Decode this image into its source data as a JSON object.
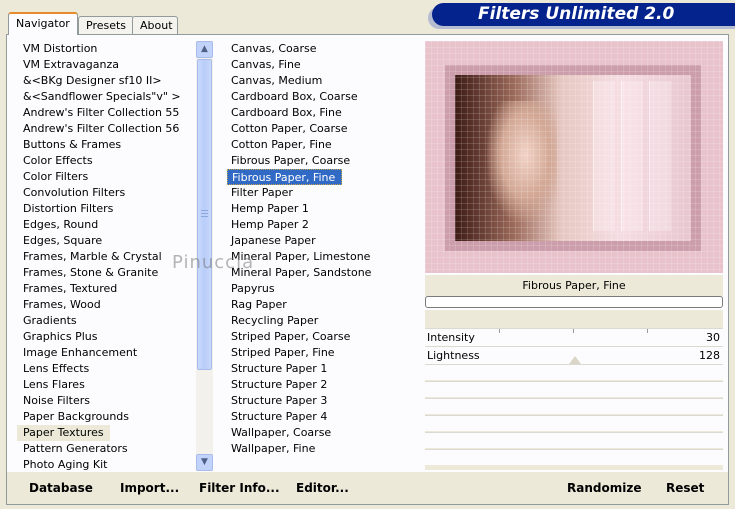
{
  "title": "Filters Unlimited 2.0",
  "tabs": [
    {
      "label": "Navigator",
      "active": true
    },
    {
      "label": "Presets",
      "active": false
    },
    {
      "label": "About",
      "active": false
    }
  ],
  "categories": [
    "VM Distortion",
    "VM Extravaganza",
    "&<BKg Designer sf10 II>",
    "&<Sandflower Specials\"v\" >",
    "Andrew's Filter Collection 55",
    "Andrew's Filter Collection 56",
    "Buttons & Frames",
    "Color Effects",
    "Color Filters",
    "Convolution Filters",
    "Distortion Filters",
    "Edges, Round",
    "Edges, Square",
    "Frames, Marble & Crystal",
    "Frames, Stone & Granite",
    "Frames, Textured",
    "Frames, Wood",
    "Gradients",
    "Graphics Plus",
    "Image Enhancement",
    "Lens Effects",
    "Lens Flares",
    "Noise Filters",
    "Paper Backgrounds",
    "Paper Textures",
    "Pattern Generators",
    "Photo Aging Kit"
  ],
  "selected_category": "Paper Textures",
  "filters": [
    "Canvas, Coarse",
    "Canvas, Fine",
    "Canvas, Medium",
    "Cardboard Box, Coarse",
    "Cardboard Box, Fine",
    "Cotton Paper, Coarse",
    "Cotton Paper, Fine",
    "Fibrous Paper, Coarse",
    "Fibrous Paper, Fine",
    "Filter Paper",
    "Hemp Paper 1",
    "Hemp Paper 2",
    "Japanese Paper",
    "Mineral Paper, Limestone",
    "Mineral Paper, Sandstone",
    "Papyrus",
    "Rag Paper",
    "Recycling Paper",
    "Striped Paper, Coarse",
    "Striped Paper, Fine",
    "Structure Paper 1",
    "Structure Paper 2",
    "Structure Paper 3",
    "Structure Paper 4",
    "Wallpaper, Coarse",
    "Wallpaper, Fine"
  ],
  "selected_filter": "Fibrous Paper, Fine",
  "filter_name": "Fibrous Paper, Fine",
  "sliders": [
    {
      "label": "Intensity",
      "value": "30",
      "fraction": 0.118
    },
    {
      "label": "Lightness",
      "value": "128",
      "fraction": 0.502
    }
  ],
  "watermark": "Pinuccia",
  "buttons": {
    "database": "Database",
    "import": "Import...",
    "filter_info": "Filter Info...",
    "editor": "Editor...",
    "randomize": "Randomize",
    "reset": "Reset"
  },
  "colors": {
    "banner": "#05238c",
    "selection": "#316ac5",
    "dialog": "#ece9d8"
  }
}
